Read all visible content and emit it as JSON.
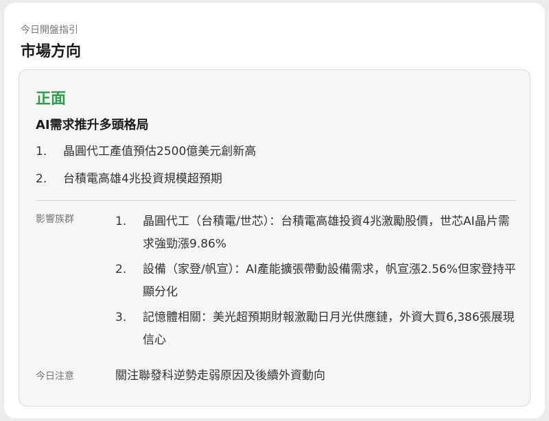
{
  "header": {
    "eyebrow": "今日開盤指引",
    "title": "市場方向"
  },
  "direction": {
    "sentiment": "正面",
    "sentiment_color": "#2e9e4b",
    "headline": "AI需求推升多頭格局",
    "points": [
      {
        "num": "1.",
        "text": "晶圓代工產值預估2500億美元創新高"
      },
      {
        "num": "2.",
        "text": "台積電高雄4兆投資規模超預期"
      }
    ]
  },
  "impact": {
    "label": "影響族群",
    "items": [
      {
        "num": "1.",
        "text": "晶圓代工（台積電/世芯）：台積電高雄投資4兆激勵股價，世芯AI晶片需求強勁漲9.86%"
      },
      {
        "num": "2.",
        "text": "設備（家登/帆宣）：AI產能擴張帶動設備需求，帆宣漲2.56%但家登持平顯分化"
      },
      {
        "num": "3.",
        "text": "記憶體相關：美光超預期財報激勵日月光供應鏈，外資大買6,386張展現信心"
      }
    ]
  },
  "note": {
    "label": "今日注意",
    "text": "關注聯發科逆勢走弱原因及後續外資動向"
  }
}
